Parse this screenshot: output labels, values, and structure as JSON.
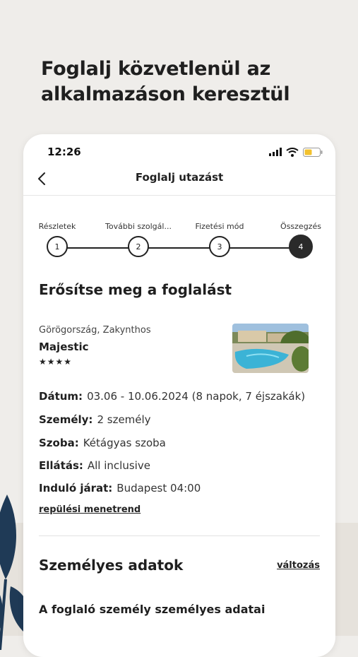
{
  "headline": "Foglalj közvetlenül az alkalmazáson keresztül",
  "status_bar": {
    "time": "12:26"
  },
  "nav": {
    "title": "Foglalj utazást"
  },
  "stepper": {
    "steps": [
      {
        "label": "Részletek",
        "number": "1"
      },
      {
        "label": "További szolgál...",
        "number": "2"
      },
      {
        "label": "Fizetési mód",
        "number": "3"
      },
      {
        "label": "Összegzés",
        "number": "4"
      }
    ],
    "active_step": 4
  },
  "confirm_title": "Erősítse meg a foglalást",
  "hotel": {
    "location": "Görögország, Zakynthos",
    "name": "Majestic",
    "stars": "★★★★"
  },
  "details": [
    {
      "key": "Dátum:",
      "value": "03.06 - 10.06.2024 (8 napok, 7 éjszakák)"
    },
    {
      "key": "Személy:",
      "value": "2 személy"
    },
    {
      "key": "Szoba:",
      "value": "Kétágyas szoba"
    },
    {
      "key": "Ellátás:",
      "value": "All inclusive"
    },
    {
      "key": "Induló járat:",
      "value": "Budapest 04:00"
    }
  ],
  "schedule_link": "repülési menetrend",
  "personal": {
    "title": "Személyes adatok",
    "change_link": "változás",
    "subtitle": "A foglaló személy személyes adatai"
  },
  "colors": {
    "accent": "#2a2a2a",
    "background": "#efedea",
    "leaf": "#1f3a56"
  }
}
